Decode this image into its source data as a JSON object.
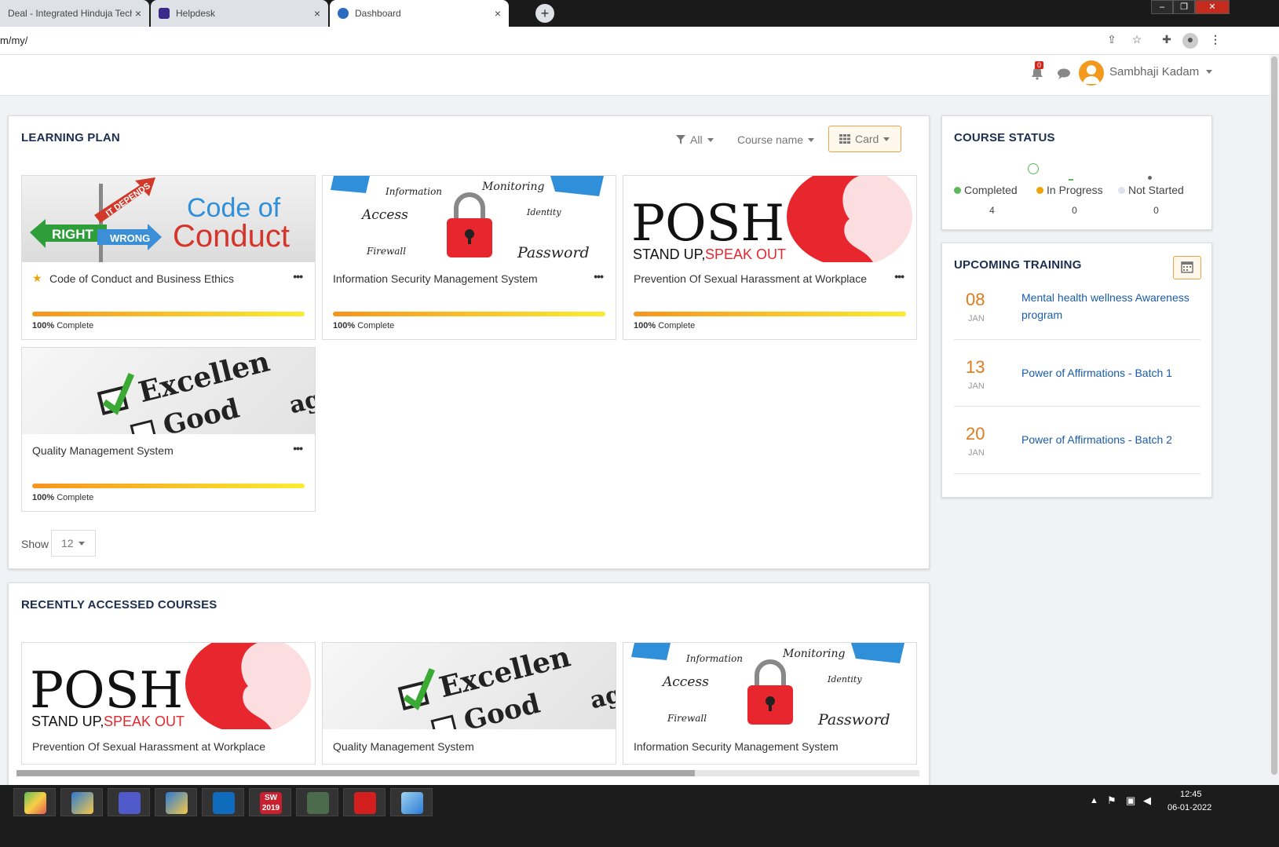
{
  "browser": {
    "tabs": [
      {
        "label": "Deal - Integrated Hinduja Tech E",
        "close": "×"
      },
      {
        "label": "Helpdesk",
        "close": "×"
      },
      {
        "label": "Dashboard",
        "close": "×"
      }
    ],
    "new_tab": "+",
    "url": "m/my/",
    "window_buttons": [
      "–",
      "❐",
      "✕"
    ]
  },
  "header": {
    "notification_count": "0",
    "user_name": "Sambhaji Kadam",
    "icons": [
      "bell-icon",
      "chat-icon",
      "avatar",
      "chevron-down-icon"
    ]
  },
  "learning_plan": {
    "title": "LEARNING PLAN",
    "filter_all": "All",
    "sort": "Course name",
    "view": "Card",
    "courses": [
      {
        "name": "Code of Conduct and Business Ethics",
        "starred": true,
        "progress_percent": 100,
        "progress_value": "100%",
        "progress_suffix": " Complete",
        "more": "•••"
      },
      {
        "name": "Information Security Management System",
        "starred": false,
        "progress_percent": 100,
        "progress_value": "100%",
        "progress_suffix": " Complete",
        "more": "•••"
      },
      {
        "name": "Prevention Of Sexual Harassment at Workplace",
        "starred": false,
        "progress_percent": 100,
        "progress_value": "100%",
        "progress_suffix": " Complete",
        "more": "•••"
      },
      {
        "name": "Quality Management System",
        "starred": false,
        "progress_percent": 100,
        "progress_value": "100%",
        "progress_suffix": " Complete",
        "more": "•••"
      }
    ],
    "show_label": "Show",
    "show_value": "12",
    "images": {
      "coc": {
        "right": "RIGHT",
        "wrong": "WRONG",
        "depends": "IT DEPENDS",
        "line1": "Code of",
        "line2": "Conduct"
      },
      "isms": {
        "words": [
          "Information",
          "Monitoring",
          "Access",
          "Identity",
          "Firewall",
          "Password"
        ]
      },
      "posh": {
        "logo": "POSH",
        "tag1": "STAND UP,",
        "tag2": "SPEAK OUT"
      },
      "qms": {
        "w1": "Excellen",
        "w2": "Good",
        "w3": "ag"
      }
    }
  },
  "course_status": {
    "title": "COURSE STATUS",
    "items": [
      {
        "label": "Completed",
        "value": "4",
        "color": "#5cb85c"
      },
      {
        "label": "In Progress",
        "value": "0",
        "color": "#f0a30a"
      },
      {
        "label": "Not Started",
        "value": "0",
        "color": "#dde3ee"
      }
    ]
  },
  "upcoming_training": {
    "title": "UPCOMING TRAINING",
    "events": [
      {
        "day": "08",
        "month": "JAN",
        "name": "Mental health wellness Awareness program"
      },
      {
        "day": "13",
        "month": "JAN",
        "name": "Power of Affirmations - Batch 1"
      },
      {
        "day": "20",
        "month": "JAN",
        "name": "Power of Affirmations - Batch 2"
      }
    ]
  },
  "recent_courses": {
    "title": "RECENTLY ACCESSED COURSES",
    "courses": [
      {
        "name": "Prevention Of Sexual Harassment at Workplace"
      },
      {
        "name": "Quality Management System"
      },
      {
        "name": "Information Security Management System"
      }
    ]
  },
  "taskbar": {
    "time": "12:45",
    "date": "06-01-2022",
    "apps": [
      "maps-icon",
      "app-icon",
      "teams-icon",
      "app-icon",
      "outlook-icon",
      "solidworks-icon",
      "monitor-icon",
      "acrobat-icon",
      "notepad-icon"
    ],
    "sw_label": "SW",
    "sw_year": "2019"
  },
  "colors": {
    "accent": "#f7941d",
    "title": "#1d2f4f",
    "link": "#1a5ca8",
    "date": "#e07b1a"
  }
}
